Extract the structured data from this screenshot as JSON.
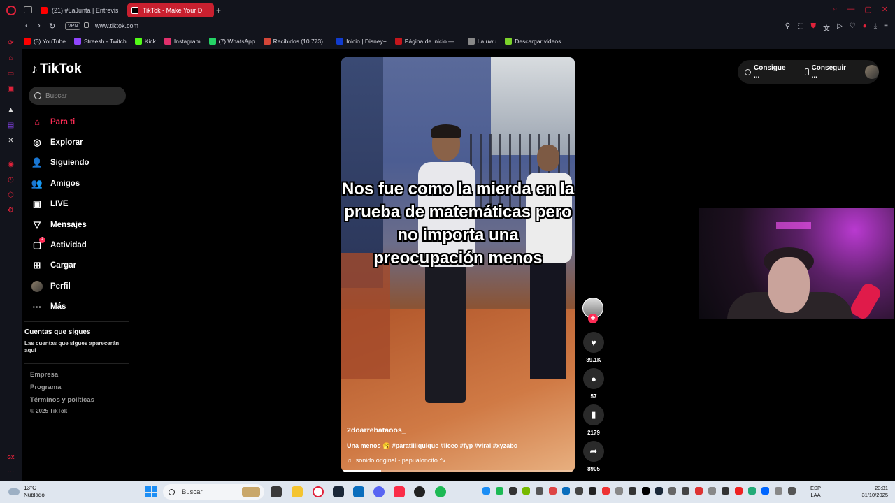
{
  "browser": {
    "tabs": [
      {
        "label": "(21) #LaJunta | Entrevista"
      },
      {
        "label": "TikTok - Make Your Day"
      }
    ],
    "url": "www.tiktok.com",
    "vpn_label": "VPN",
    "bookmarks": [
      {
        "label": "(3) YouTube",
        "color": "#ff0000"
      },
      {
        "label": "Streesh - Twitch",
        "color": "#9146ff"
      },
      {
        "label": "Kick",
        "color": "#53fc18"
      },
      {
        "label": "Instagram",
        "color": "#e1306c"
      },
      {
        "label": "(7) WhatsApp",
        "color": "#25d366"
      },
      {
        "label": "Recibidos (10.773)...",
        "color": "#d44638"
      },
      {
        "label": "Inicio | Disney+",
        "color": "#113ccf"
      },
      {
        "label": "Página de inicio —...",
        "color": "#c4161c"
      },
      {
        "label": "La uwu",
        "color": "#888888"
      },
      {
        "label": "Descargar videos...",
        "color": "#7cd32b"
      }
    ],
    "sidebar_bottom_label": "GX"
  },
  "tiktok": {
    "logo": "TikTok",
    "search_placeholder": "Buscar",
    "menu": [
      {
        "label": "Para ti",
        "icon": "home-icon",
        "glyph": "⌂"
      },
      {
        "label": "Explorar",
        "icon": "compass-icon",
        "glyph": "◎"
      },
      {
        "label": "Siguiendo",
        "icon": "following-icon",
        "glyph": "👤"
      },
      {
        "label": "Amigos",
        "icon": "friends-icon",
        "glyph": "👥"
      },
      {
        "label": "LIVE",
        "icon": "live-icon",
        "glyph": "▣"
      },
      {
        "label": "Mensajes",
        "icon": "messages-icon",
        "glyph": "▽"
      },
      {
        "label": "Actividad",
        "icon": "activity-icon",
        "glyph": "▢",
        "badge": "2"
      },
      {
        "label": "Cargar",
        "icon": "upload-icon",
        "glyph": "⊞"
      },
      {
        "label": "Perfil",
        "icon": "profile-avatar-icon",
        "glyph": ""
      },
      {
        "label": "Más",
        "icon": "more-icon",
        "glyph": "···"
      }
    ],
    "following_title": "Cuentas que sigues",
    "following_desc": "Las cuentas que sigues aparecerán aquí",
    "footer_links": [
      "Empresa",
      "Programa",
      "Términos y políticas"
    ],
    "copyright": "© 2025 TikTok",
    "top_buttons": {
      "coins": "Consigue ...",
      "app": "Conseguir ..."
    }
  },
  "video": {
    "caption_overlay": "Nos fue como la mierda en la prueba de matemáticas pero no importa una preocupación menos",
    "author": "2doarrebataoos_",
    "description": "Una menos 🥱 #paratiiiiquique #liceo #fyp #viral #xyzabc",
    "sound": "sonido original - papualoncito :'v",
    "progress": 0.17,
    "likes": "39.1K",
    "comments": "57",
    "saves": "2179",
    "shares": "8905"
  },
  "taskbar": {
    "temperature": "13°C",
    "weather": "Nublado",
    "search_placeholder": "Buscar",
    "language_top": "ESP",
    "language_bottom": "LAA",
    "time": "23:31",
    "date": "31/10/2025"
  }
}
